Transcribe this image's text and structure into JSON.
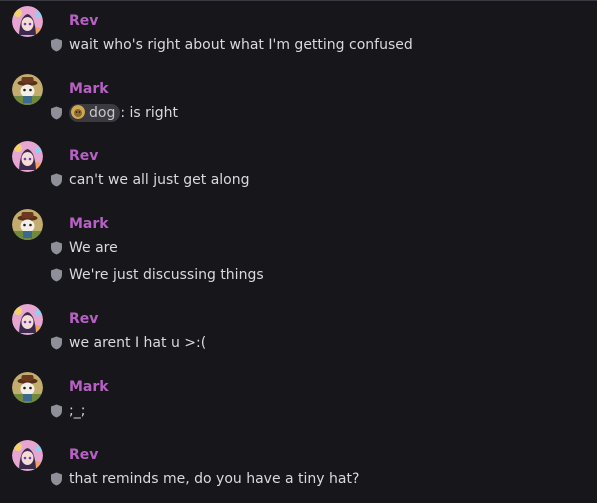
{
  "colors": {
    "background": "#17171b",
    "username": "#b761c4",
    "message_text": "#dadade",
    "shield": "#8e8f99",
    "mention_bg": "#3a3a40"
  },
  "icons": {
    "rev_avatar": "anime-avatar-icon",
    "mark_avatar": "hat-avatar-icon",
    "message_marker": "shield-icon"
  },
  "groups": [
    {
      "author": "Rev",
      "messages": [
        "wait who's right about what I'm getting confused"
      ]
    },
    {
      "author": "Mark",
      "messages": [
        {
          "mention": "dog",
          "suffix": ": is right"
        }
      ]
    },
    {
      "author": "Rev",
      "messages": [
        "can't we all just get along"
      ]
    },
    {
      "author": "Mark",
      "messages": [
        "We are",
        "We're just discussing things"
      ]
    },
    {
      "author": "Rev",
      "messages": [
        "we arent I hat u >:("
      ]
    },
    {
      "author": "Mark",
      "messages": [
        ";_;"
      ]
    },
    {
      "author": "Rev",
      "messages": [
        "that reminds me, do you have a tiny hat?"
      ]
    }
  ]
}
